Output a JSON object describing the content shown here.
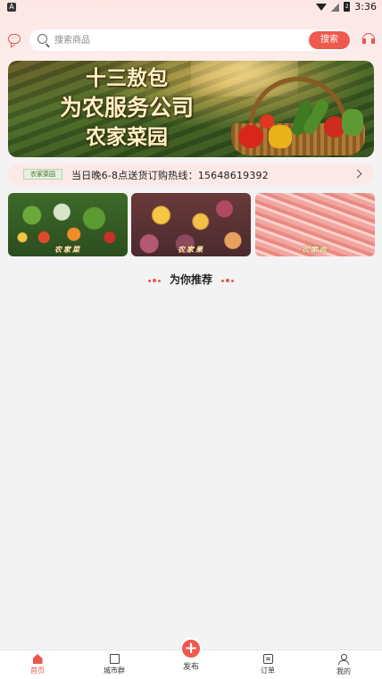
{
  "status_bar": {
    "time": "3:36",
    "left_icon": "A",
    "battery_label": "2"
  },
  "search": {
    "placeholder": "搜索商品",
    "button_label": "搜索"
  },
  "banner": {
    "line1": "十三敖包",
    "line2": "为农服务公司",
    "line3": "农家菜园"
  },
  "notice": {
    "logo_text": "农家菜园",
    "text": "当日晚6-8点送货订购热线：15648619392"
  },
  "categories": [
    {
      "label": "农家菜",
      "icon": "vegetables-image"
    },
    {
      "label": "农家果",
      "icon": "fruits-image"
    },
    {
      "label": "农家肉",
      "icon": "meat-image"
    }
  ],
  "section": {
    "title": "为你推荐"
  },
  "bottom_nav": {
    "items": [
      {
        "label": "首页",
        "icon": "home-icon",
        "active": true
      },
      {
        "label": "城市群",
        "icon": "city-icon",
        "active": false
      },
      {
        "label": "发布",
        "icon": "plus-icon",
        "active": false
      },
      {
        "label": "订单",
        "icon": "order-icon",
        "active": false
      },
      {
        "label": "我的",
        "icon": "user-icon",
        "active": false
      }
    ]
  },
  "colors": {
    "accent": "#ef5a4e",
    "background": "#f3f3f3",
    "notice_bg": "#fbe9e8"
  }
}
